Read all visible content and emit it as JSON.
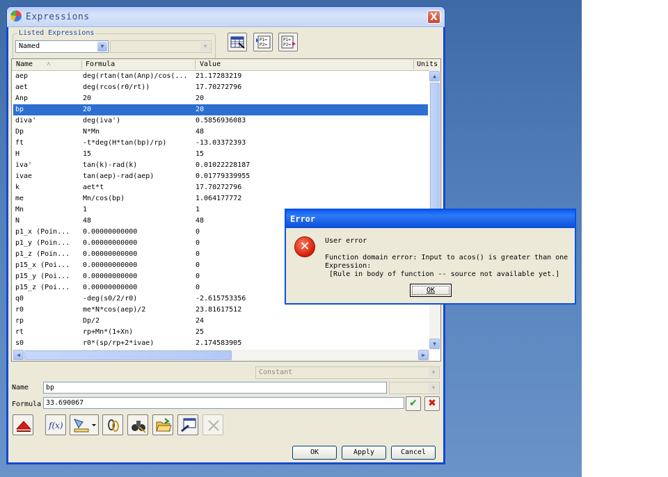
{
  "window": {
    "title": "Expressions",
    "close_label": "X"
  },
  "listed": {
    "group_label": "Listed Expressions",
    "filter_value": "Named",
    "filter2_value": ""
  },
  "table": {
    "columns": [
      "Name",
      "Formula",
      "Value",
      "Units"
    ],
    "rows": [
      {
        "name": "aep",
        "formula": "deg(rtan(tan(Anp)/cos(...",
        "value": "21.17283219"
      },
      {
        "name": "aet",
        "formula": "deg(rcos(r0/rt))",
        "value": "17.70272796"
      },
      {
        "name": "Anp",
        "formula": "20",
        "value": "20"
      },
      {
        "name": "bp",
        "formula": "20",
        "value": "20"
      },
      {
        "name": "diva'",
        "formula": "deg(iva')",
        "value": "0.5856936083"
      },
      {
        "name": "Dp",
        "formula": "N*Mn",
        "value": "48"
      },
      {
        "name": "ft",
        "formula": "-t*deg(H*tan(bp)/rp)",
        "value": "-13.03372393"
      },
      {
        "name": "H",
        "formula": "15",
        "value": "15"
      },
      {
        "name": "iva'",
        "formula": "tan(k)-rad(k)",
        "value": "0.01022228187"
      },
      {
        "name": "ivae",
        "formula": "tan(aep)-rad(aep)",
        "value": "0.01779339955"
      },
      {
        "name": "k",
        "formula": "aet*t",
        "value": "17.70272796"
      },
      {
        "name": "me",
        "formula": "Mn/cos(bp)",
        "value": "1.064177772"
      },
      {
        "name": "Mn",
        "formula": "1",
        "value": "1"
      },
      {
        "name": "N",
        "formula": "48",
        "value": "48"
      },
      {
        "name": "p1_x  (Poin...",
        "formula": "0.00000000000",
        "value": "0"
      },
      {
        "name": "p1_y  (Poin...",
        "formula": "0.00000000000",
        "value": "0"
      },
      {
        "name": "p1_z  (Poin...",
        "formula": "0.00000000000",
        "value": "0"
      },
      {
        "name": "p15_x  (Poi...",
        "formula": "0.00000000000",
        "value": "0"
      },
      {
        "name": "p15_y  (Poi...",
        "formula": "0.00000000000",
        "value": "0"
      },
      {
        "name": "p15_z  (Poi...",
        "formula": "0.00000000000",
        "value": "0"
      },
      {
        "name": "q0",
        "formula": "-deg(s0/2/r0)",
        "value": "-2.615753356"
      },
      {
        "name": "r0",
        "formula": "me*N*cos(aep)/2",
        "value": "23.81617512"
      },
      {
        "name": "rp",
        "formula": "Dp/2",
        "value": "24"
      },
      {
        "name": "rt",
        "formula": "rp+Mn*(1+Xn)",
        "value": "25"
      },
      {
        "name": "s0",
        "formula": "r0*(sp/rp+2*ivae)",
        "value": "2.174583905"
      }
    ],
    "selected_index": 3
  },
  "type_select": {
    "value": "Constant"
  },
  "name_field": {
    "label": "Name",
    "value": "bp"
  },
  "formula_field": {
    "label": "Formula",
    "value": "33.690067"
  },
  "buttons": {
    "ok": "OK",
    "apply": "Apply",
    "cancel": "Cancel"
  },
  "error": {
    "title": "Error",
    "line1": "User error",
    "line2": "Function domain error: Input to acos() is greater than one",
    "line3": "Expression:",
    "line4": " [Rule in body of function -- source not available yet.]",
    "ok": "OK"
  }
}
